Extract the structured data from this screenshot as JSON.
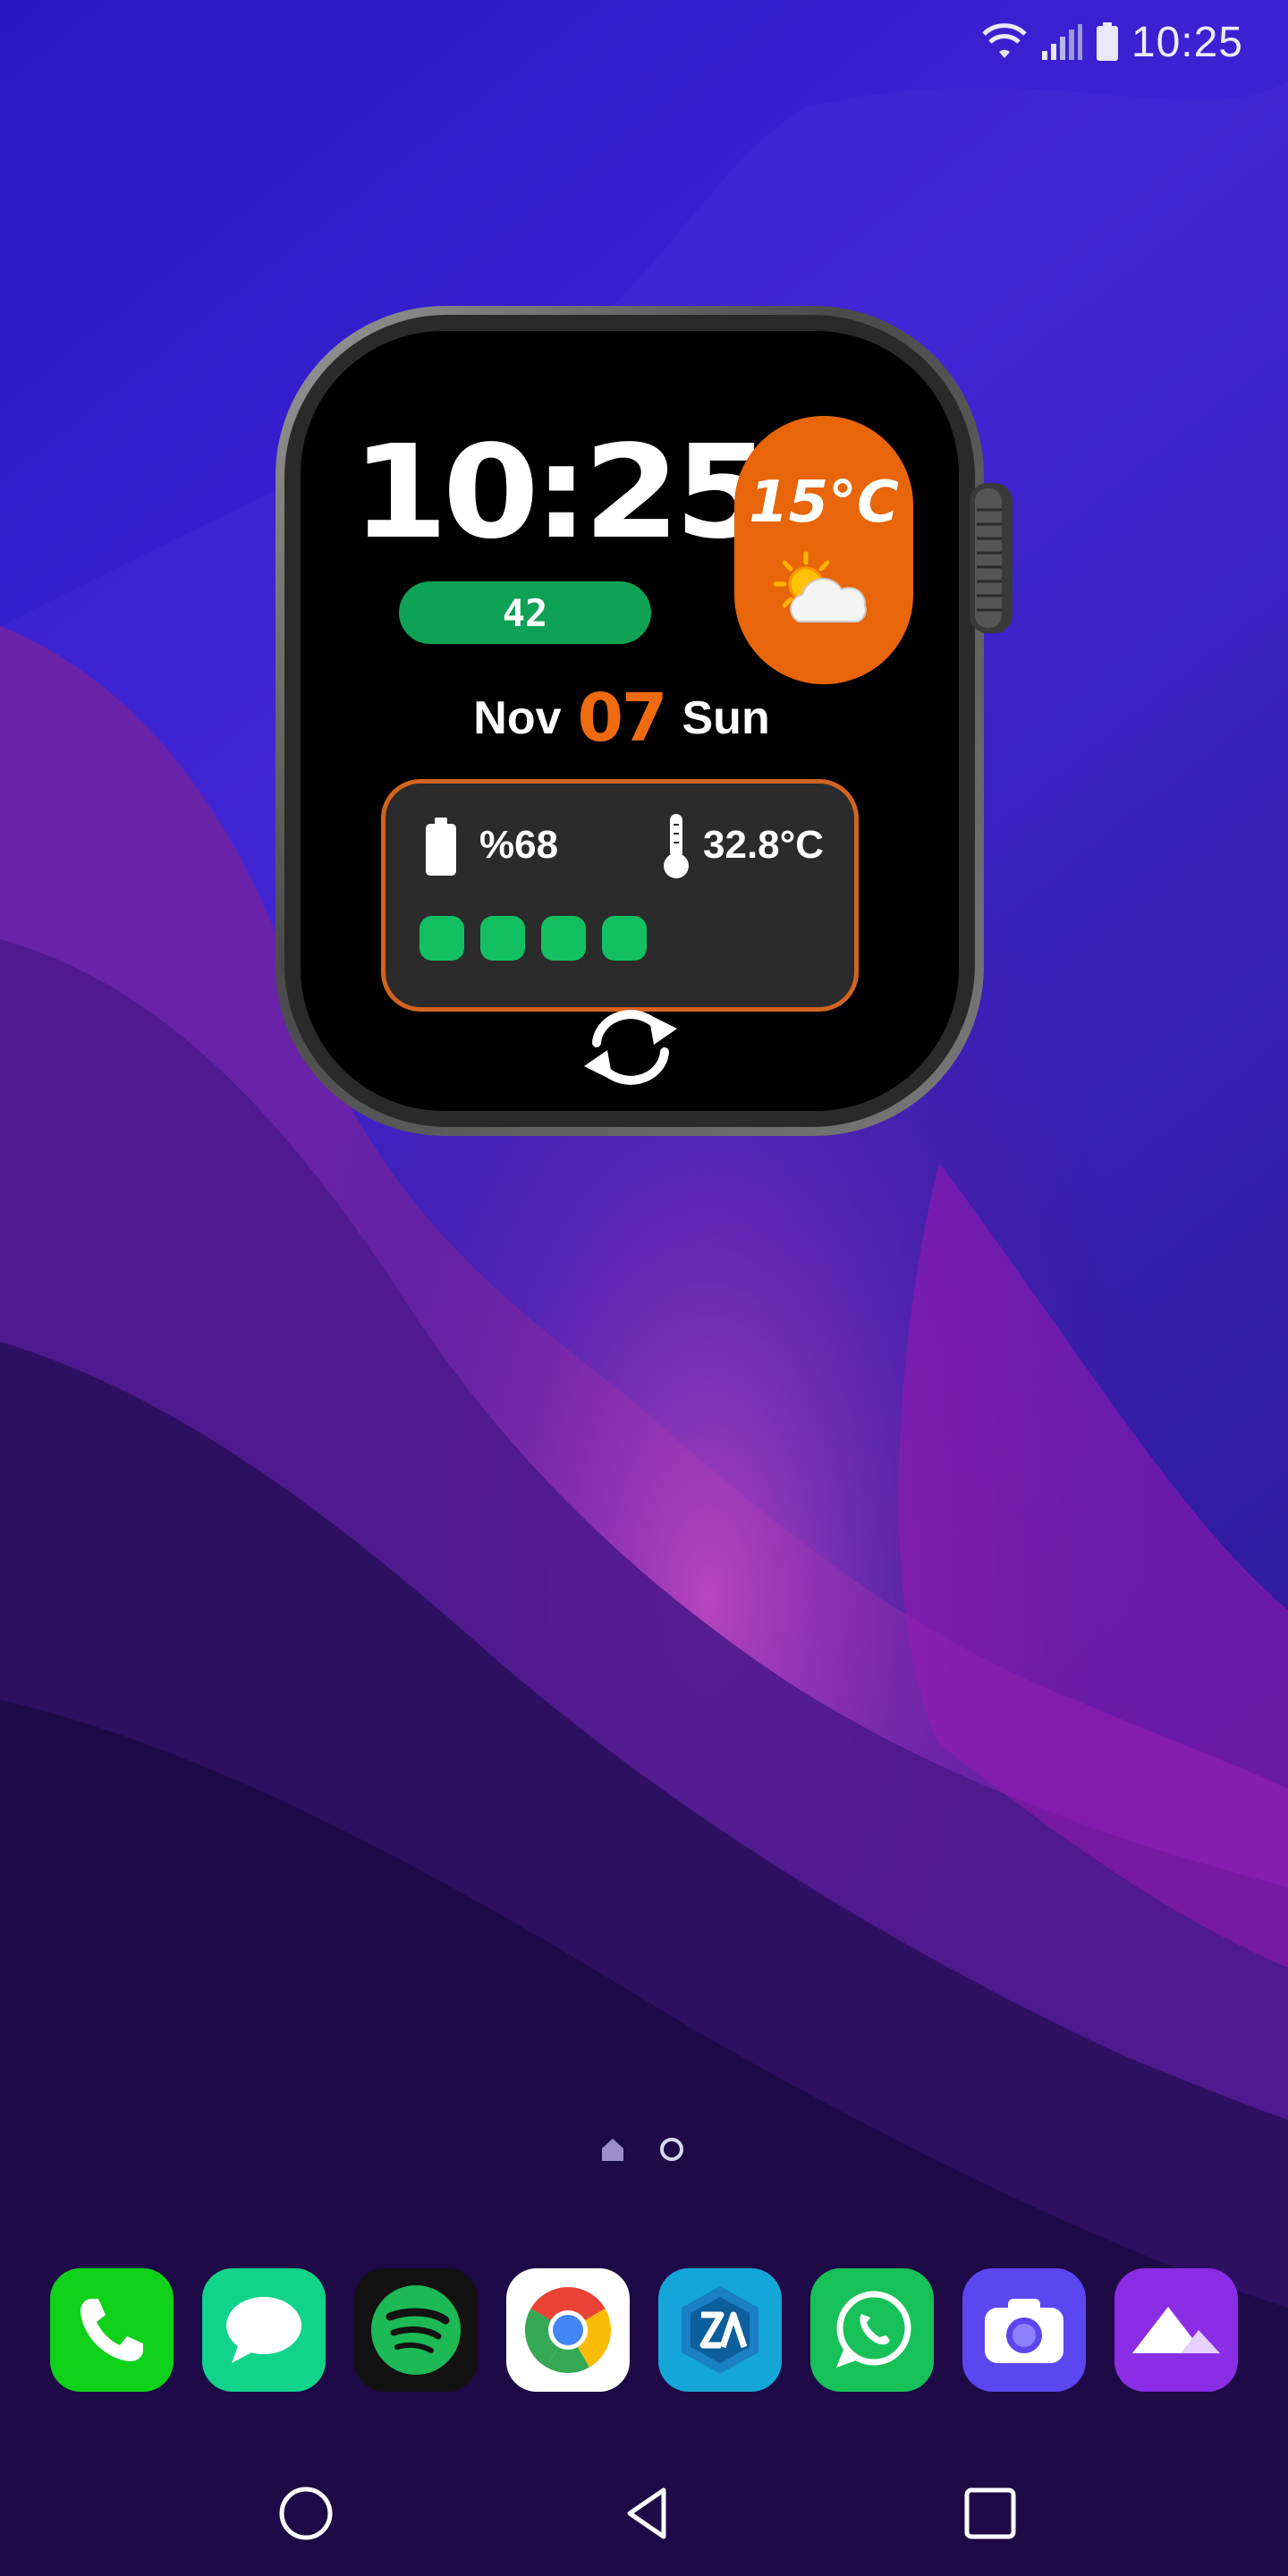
{
  "status_bar": {
    "time": "10:25",
    "icons": [
      "wifi-icon",
      "signal-icon",
      "battery-icon"
    ]
  },
  "watch_widget": {
    "time": "10:25",
    "steps": "42",
    "weather": {
      "temperature": "15°C",
      "icon": "partly-cloudy-icon",
      "accent_color": "#e8650a"
    },
    "date": {
      "month": "Nov",
      "day": "07",
      "weekday": "Sun"
    },
    "info_panel": {
      "battery": "%68",
      "device_temperature": "32.8°C",
      "level_dots": 4,
      "border_color": "#d36420",
      "dot_color": "#12c062"
    },
    "refresh_icon": "refresh-icon"
  },
  "home_screen": {
    "pages": [
      "home",
      "page-2"
    ],
    "active_page": 0
  },
  "dock": {
    "apps": [
      {
        "name": "Phone",
        "icon": "phone-icon",
        "color": "#0fd11a"
      },
      {
        "name": "Messages",
        "icon": "message-icon",
        "color": "#12d38a"
      },
      {
        "name": "Spotify",
        "icon": "spotify-icon",
        "color": "#121212"
      },
      {
        "name": "Chrome",
        "icon": "chrome-icon",
        "color": "#ffffff"
      },
      {
        "name": "ZArchiver",
        "icon": "zarchiver-icon",
        "color": "#15a6d9"
      },
      {
        "name": "WhatsApp",
        "icon": "whatsapp-icon",
        "color": "#18c158"
      },
      {
        "name": "Camera",
        "icon": "camera-icon",
        "color": "#5a47f0"
      },
      {
        "name": "Gallery",
        "icon": "gallery-icon",
        "color": "#8c2de6"
      }
    ]
  },
  "nav_bar": {
    "buttons": [
      "home-icon",
      "back-icon",
      "recents-icon"
    ]
  }
}
